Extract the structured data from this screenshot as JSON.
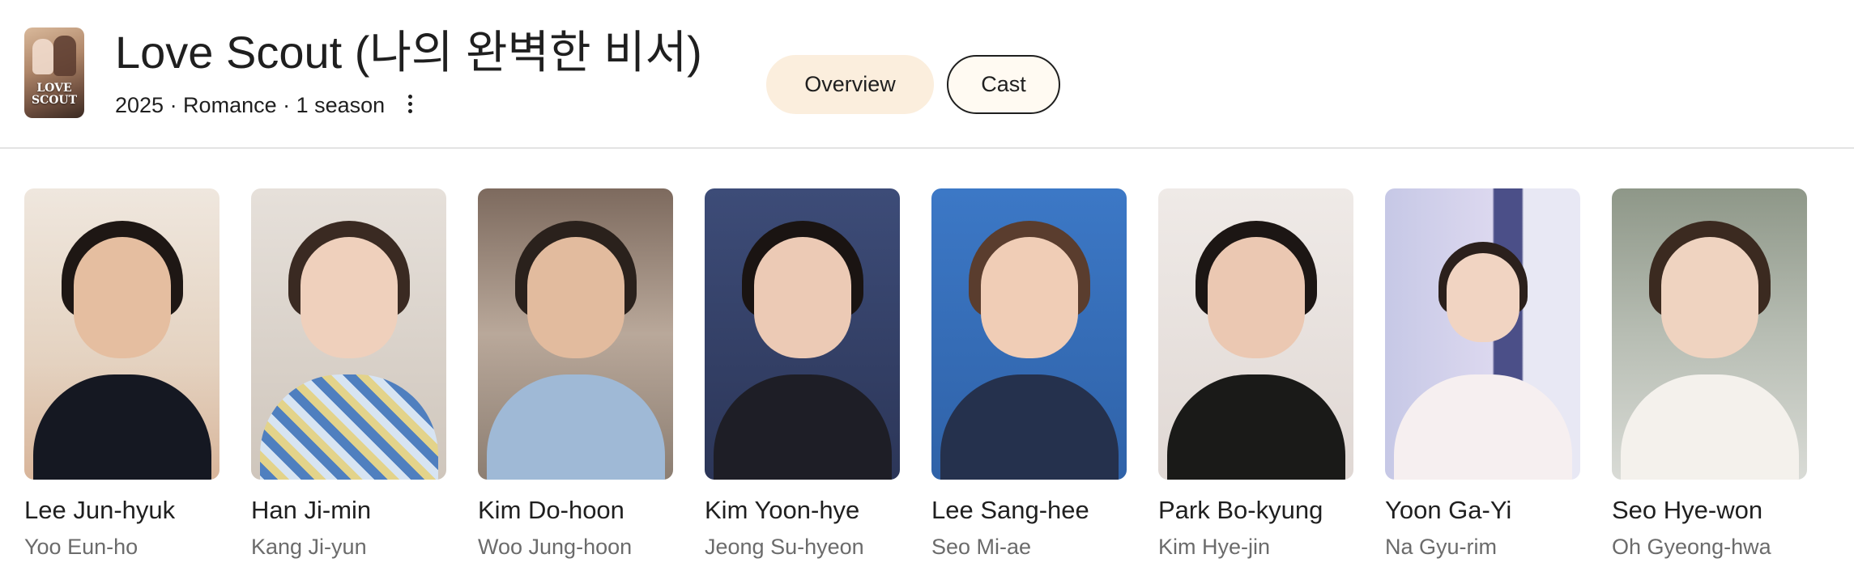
{
  "header": {
    "poster_text": "LOVE\nSCOUT",
    "title": "Love Scout (나의 완벽한 비서)",
    "meta": "2025 · Romance · 1 season",
    "tabs": [
      {
        "label": "Overview",
        "selected": false
      },
      {
        "label": "Cast",
        "selected": true
      }
    ]
  },
  "cast": [
    {
      "name": "Lee Jun-hyuk",
      "role": "Yoo Eun-ho"
    },
    {
      "name": "Han Ji-min",
      "role": "Kang Ji-yun"
    },
    {
      "name": "Kim Do-hoon",
      "role": "Woo Jung-hoon"
    },
    {
      "name": "Kim Yoon-hye",
      "role": "Jeong Su-hyeon"
    },
    {
      "name": "Lee Sang-hee",
      "role": "Seo Mi-ae"
    },
    {
      "name": "Park Bo-kyung",
      "role": "Kim Hye-jin"
    },
    {
      "name": "Yoon Ga-Yi",
      "role": "Na Gyu-rim"
    },
    {
      "name": "Seo Hye-won",
      "role": "Oh Gyeong-hwa"
    }
  ],
  "colors": {
    "chip_overview_bg": "#fbeedd",
    "chip_cast_border": "#1f1f1f",
    "role_text": "#6b6b6b"
  }
}
